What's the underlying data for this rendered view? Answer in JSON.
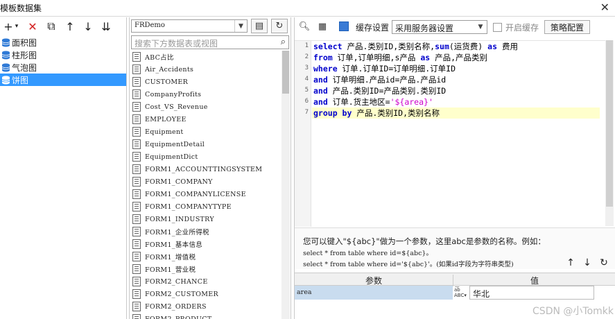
{
  "window": {
    "title": "模板数据集",
    "close_glyph": "✕"
  },
  "left": {
    "toolbar": {
      "add": "+",
      "add_arrow": "▾",
      "delete": "✕",
      "copy": "⧉",
      "up": "↑",
      "down": "↓",
      "sort": "⇊"
    },
    "datasets": [
      {
        "label": "面积图"
      },
      {
        "label": "柱形图"
      },
      {
        "label": "气泡图"
      },
      {
        "label": "饼图"
      }
    ]
  },
  "middle": {
    "connection": "FRDemo",
    "search_placeholder": "搜索下方数据表或视图",
    "tables": [
      "ABC占比",
      "Air_Accidents",
      "CUSTOMER",
      "CompanyProfits",
      "Cost_VS_Revenue",
      "EMPLOYEE",
      "Equipment",
      "EquipmentDetail",
      "EquipmentDict",
      "FORM1_ACCOUNTTINGSYSTEM",
      "FORM1_COMPANY",
      "FORM1_COMPANYLICENSE",
      "FORM1_COMPANYTYPE",
      "FORM1_INDUSTRY",
      "FORM1_企业所得税",
      "FORM1_基本信息",
      "FORM1_增值税",
      "FORM1_营业税",
      "FORM2_CHANCE",
      "FORM2_CUSTOMER",
      "FORM2_ORDERS",
      "FORM2_PRODUCT"
    ]
  },
  "right": {
    "toolbar": {
      "cache_label": "缓存设置",
      "cache_option": "采用服务器设置",
      "enable_cache_label": "开启缓存",
      "strategy_button": "策略配置"
    },
    "sql_lines": [
      "1",
      "2",
      "3",
      "4",
      "5",
      "6",
      "7"
    ],
    "hint": {
      "line1": "您可以键入\"${abc}\"做为一个参数，这里abc是参数的名称。例如：",
      "line2": "select * from table where id=${abc}。",
      "line3": "select * from table where id='${abc}'。(如果id字段为字符串类型)"
    },
    "params": {
      "header_param": "参数",
      "header_value": "值",
      "rows": [
        {
          "name": "area",
          "type_icon": "abc",
          "value": "华北"
        }
      ]
    }
  },
  "watermark": "CSDN @小Tomkk",
  "colors": {
    "selection": "#3399ff",
    "keyword": "#0000cc",
    "string": "#cc00cc",
    "highlight_line": "#ffffcc"
  }
}
